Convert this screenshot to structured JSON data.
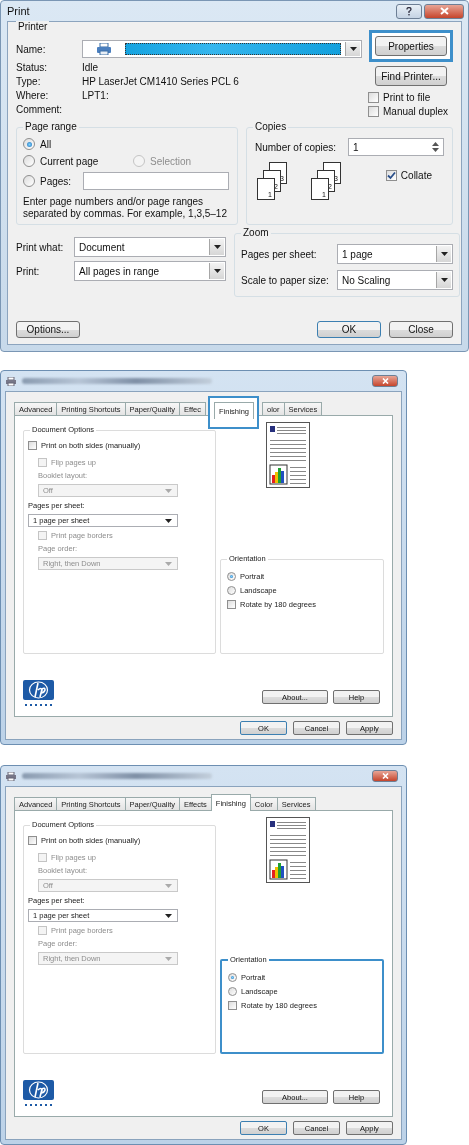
{
  "print_dialog": {
    "title": "Print",
    "printer": {
      "legend": "Printer",
      "name_label": "Name:",
      "status_label": "Status:",
      "status": "Idle",
      "type_label": "Type:",
      "type": "HP LaserJet CM1410 Series PCL 6",
      "where_label": "Where:",
      "where": "LPT1:",
      "comment_label": "Comment:"
    },
    "properties_button": {
      "label": "Properties",
      "highlighted": true
    },
    "find_printer_button": "Find Printer...",
    "checks": [
      {
        "label": "Print to file",
        "checked": false
      },
      {
        "label": "Manual duplex",
        "checked": false
      }
    ],
    "page_range": {
      "legend": "Page range",
      "options": [
        {
          "label": "All",
          "selected": true,
          "disabled": false
        },
        {
          "label": "Current page",
          "selected": false,
          "disabled": false
        },
        {
          "label": "Selection",
          "selected": false,
          "disabled": true
        },
        {
          "label": "Pages:",
          "selected": false,
          "disabled": false
        }
      ],
      "hint": "Enter page numbers and/or page ranges separated by commas.  For example, 1,3,5–12"
    },
    "copies": {
      "legend": "Copies",
      "label": "Number of copies:",
      "value": "1",
      "stacks": [
        [
          "1",
          "2",
          "3"
        ],
        [
          "1",
          "2",
          "3"
        ]
      ],
      "collate": {
        "label": "Collate",
        "checked": true
      }
    },
    "print_what": {
      "label": "Print what:",
      "value": "Document"
    },
    "print": {
      "label": "Print:",
      "value": "All pages in range"
    },
    "zoom": {
      "legend": "Zoom",
      "rows": [
        {
          "label": "Pages per sheet:",
          "value": "1 page"
        },
        {
          "label": "Scale to paper size:",
          "value": "No Scaling"
        }
      ]
    },
    "options_button": "Options...",
    "ok_button": "OK",
    "close_button": "Close"
  },
  "properties_dialogs": [
    {
      "tabs": [
        {
          "label": "Advanced",
          "selected": false,
          "highlighted": false
        },
        {
          "label": "Printing Shortcuts",
          "selected": false,
          "highlighted": false
        },
        {
          "label": "Paper/Quality",
          "selected": false,
          "highlighted": false
        },
        {
          "label": "Effec",
          "selected": false,
          "highlighted": false
        },
        {
          "label": "Finishing",
          "selected": true,
          "highlighted": true
        },
        {
          "label": "olor",
          "selected": false,
          "highlighted": false
        },
        {
          "label": "Services",
          "selected": false,
          "highlighted": false
        }
      ],
      "document_options": {
        "legend": "Document Options",
        "both_sides": {
          "label": "Print on both sides (manually)",
          "checked": false,
          "disabled": false
        },
        "flip_pages": {
          "label": "Flip pages up",
          "checked": false,
          "disabled": true
        },
        "booklet": {
          "label": "Booklet layout:",
          "value": "Off",
          "disabled": true
        },
        "pages_per_sheet": {
          "label": "Pages per sheet:",
          "value": "1 page per sheet",
          "disabled": false
        },
        "page_borders": {
          "label": "Print page borders",
          "checked": false,
          "disabled": true
        },
        "page_order": {
          "label": "Page order:",
          "value": "Right, then Down",
          "disabled": true
        }
      },
      "orientation": {
        "legend": "Orientation",
        "highlighted": false,
        "options": [
          {
            "label": "Portrait",
            "selected": true
          },
          {
            "label": "Landscape",
            "selected": false
          }
        ],
        "rotate": {
          "label": "Rotate by 180 degrees",
          "checked": false
        }
      },
      "about_button": "About...",
      "help_button": "Help",
      "ok_button": "OK",
      "cancel_button": "Cancel",
      "apply_button": "Apply"
    },
    {
      "tabs": [
        {
          "label": "Advanced",
          "selected": false,
          "highlighted": false
        },
        {
          "label": "Printing Shortcuts",
          "selected": false,
          "highlighted": false
        },
        {
          "label": "Paper/Quality",
          "selected": false,
          "highlighted": false
        },
        {
          "label": "Effects",
          "selected": false,
          "highlighted": false
        },
        {
          "label": "Finishing",
          "selected": true,
          "highlighted": false
        },
        {
          "label": "Color",
          "selected": false,
          "highlighted": false
        },
        {
          "label": "Services",
          "selected": false,
          "highlighted": false
        }
      ],
      "document_options": {
        "legend": "Document Options",
        "both_sides": {
          "label": "Print on both sides (manually)",
          "checked": false,
          "disabled": false
        },
        "flip_pages": {
          "label": "Flip pages up",
          "checked": false,
          "disabled": true
        },
        "booklet": {
          "label": "Booklet layout:",
          "value": "Off",
          "disabled": true
        },
        "pages_per_sheet": {
          "label": "Pages per sheet:",
          "value": "1 page per sheet",
          "disabled": false
        },
        "page_borders": {
          "label": "Print page borders",
          "checked": false,
          "disabled": true
        },
        "page_order": {
          "label": "Page order:",
          "value": "Right, then Down",
          "disabled": true
        }
      },
      "orientation": {
        "legend": "Orientation",
        "highlighted": true,
        "options": [
          {
            "label": "Portrait",
            "selected": true
          },
          {
            "label": "Landscape",
            "selected": false
          }
        ],
        "rotate": {
          "label": "Rotate by 180 degrees",
          "checked": false
        }
      },
      "about_button": "About...",
      "help_button": "Help",
      "ok_button": "OK",
      "cancel_button": "Cancel",
      "apply_button": "Apply"
    }
  ]
}
